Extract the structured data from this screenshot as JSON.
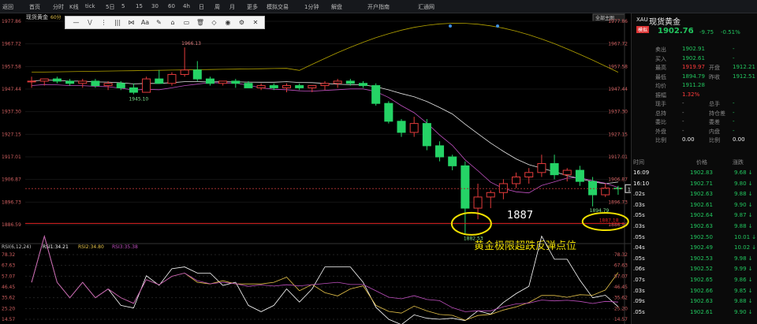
{
  "topbar": {
    "items": [
      "返回",
      "首页",
      "分时",
      "K线",
      "tick",
      "5日",
      "5",
      "15",
      "30",
      "60",
      "4h",
      "日",
      "周",
      "月",
      "更多",
      "模拟交易",
      "1分钟",
      "解盘",
      "开户指南",
      "汇通网"
    ]
  },
  "chart": {
    "title": "现货黄金",
    "period": "60分",
    "price_ticks": [
      "1977.86",
      "1967.72",
      "1957.58",
      "1947.44",
      "1937.30",
      "1927.15",
      "1917.01",
      "1906.87",
      "1896.73",
      "1886.59"
    ],
    "labels": {
      "high": "1966.13",
      "low_left": "1945.10",
      "low": "1882.53",
      "low_right": "1894.79",
      "last": "1902.76",
      "level": "1887.18",
      "level_note": "1887",
      "caption": "黄金极限超跌反弹点位",
      "main_indicator": "全部主图"
    },
    "rsi": {
      "header": "RSI(6,12,24)",
      "r1": "RSI1:34.21",
      "r2": "RSI2:34.80",
      "r3": "RSI3:35.38",
      "ticks": [
        "78.32",
        "67.63",
        "57.07",
        "46.45",
        "35.62",
        "25.20",
        "14.57"
      ]
    },
    "colors": {
      "up": "#e23b3b",
      "down": "#25d366",
      "ma1": "#e6e6e6",
      "ma2": "#b4a300",
      "ma3": "#c050c0"
    }
  },
  "chart_data": {
    "type": "candlestick",
    "x_count": 47,
    "candles": [
      {
        "o": 1951,
        "h": 1953,
        "l": 1948,
        "c": 1951
      },
      {
        "o": 1951,
        "h": 1952,
        "l": 1949,
        "c": 1952
      },
      {
        "o": 1952,
        "h": 1953,
        "l": 1950,
        "c": 1951
      },
      {
        "o": 1951,
        "h": 1952,
        "l": 1949,
        "c": 1950
      },
      {
        "o": 1950,
        "h": 1952,
        "l": 1948,
        "c": 1951
      },
      {
        "o": 1951,
        "h": 1952,
        "l": 1948,
        "c": 1949
      },
      {
        "o": 1949,
        "h": 1951,
        "l": 1947,
        "c": 1950
      },
      {
        "o": 1950,
        "h": 1951,
        "l": 1947,
        "c": 1948
      },
      {
        "o": 1948,
        "h": 1950,
        "l": 1945.1,
        "c": 1946
      },
      {
        "o": 1946,
        "h": 1953,
        "l": 1946,
        "c": 1952
      },
      {
        "o": 1952,
        "h": 1956,
        "l": 1950,
        "c": 1950
      },
      {
        "o": 1950,
        "h": 1955,
        "l": 1949,
        "c": 1954
      },
      {
        "o": 1954,
        "h": 1966.13,
        "l": 1953,
        "c": 1956
      },
      {
        "o": 1956,
        "h": 1960,
        "l": 1951,
        "c": 1952
      },
      {
        "o": 1952,
        "h": 1953,
        "l": 1949,
        "c": 1950
      },
      {
        "o": 1950,
        "h": 1951,
        "l": 1949,
        "c": 1951
      },
      {
        "o": 1951,
        "h": 1952,
        "l": 1948,
        "c": 1950
      },
      {
        "o": 1950,
        "h": 1951,
        "l": 1948,
        "c": 1948
      },
      {
        "o": 1948,
        "h": 1950,
        "l": 1947,
        "c": 1949
      },
      {
        "o": 1949,
        "h": 1950,
        "l": 1947,
        "c": 1948
      },
      {
        "o": 1948,
        "h": 1950,
        "l": 1946,
        "c": 1949
      },
      {
        "o": 1949,
        "h": 1950,
        "l": 1947,
        "c": 1948
      },
      {
        "o": 1948,
        "h": 1949,
        "l": 1946,
        "c": 1949
      },
      {
        "o": 1949,
        "h": 1951,
        "l": 1947,
        "c": 1950
      },
      {
        "o": 1950,
        "h": 1952,
        "l": 1948,
        "c": 1951
      },
      {
        "o": 1951,
        "h": 1952,
        "l": 1949,
        "c": 1950
      },
      {
        "o": 1950,
        "h": 1951,
        "l": 1948,
        "c": 1949
      },
      {
        "o": 1949,
        "h": 1950,
        "l": 1940,
        "c": 1941
      },
      {
        "o": 1941,
        "h": 1942,
        "l": 1932,
        "c": 1933
      },
      {
        "o": 1933,
        "h": 1934,
        "l": 1926,
        "c": 1928
      },
      {
        "o": 1928,
        "h": 1935,
        "l": 1926,
        "c": 1932
      },
      {
        "o": 1932,
        "h": 1934,
        "l": 1920,
        "c": 1922
      },
      {
        "o": 1922,
        "h": 1924,
        "l": 1915,
        "c": 1917
      },
      {
        "o": 1917,
        "h": 1918,
        "l": 1911,
        "c": 1913
      },
      {
        "o": 1913,
        "h": 1915,
        "l": 1882.53,
        "c": 1894
      },
      {
        "o": 1894,
        "h": 1905,
        "l": 1889,
        "c": 1899
      },
      {
        "o": 1899,
        "h": 1902,
        "l": 1894,
        "c": 1901
      },
      {
        "o": 1901,
        "h": 1907,
        "l": 1898,
        "c": 1905
      },
      {
        "o": 1905,
        "h": 1910,
        "l": 1903,
        "c": 1908
      },
      {
        "o": 1908,
        "h": 1912,
        "l": 1905,
        "c": 1910
      },
      {
        "o": 1910,
        "h": 1918,
        "l": 1908,
        "c": 1914
      },
      {
        "o": 1914,
        "h": 1918,
        "l": 1907,
        "c": 1909
      },
      {
        "o": 1909,
        "h": 1912,
        "l": 1906,
        "c": 1911
      },
      {
        "o": 1911,
        "h": 1913,
        "l": 1904,
        "c": 1906
      },
      {
        "o": 1906,
        "h": 1908,
        "l": 1894.79,
        "c": 1900
      },
      {
        "o": 1900,
        "h": 1905,
        "l": 1899,
        "c": 1903
      },
      {
        "o": 1903,
        "h": 1904,
        "l": 1900,
        "c": 1902.76
      }
    ],
    "ylim": [
      1886.59,
      1977.86
    ]
  },
  "side": {
    "code": "XAU",
    "name": "现货黄金",
    "tag": "模拟",
    "price": "1902.76",
    "arrow": "↓",
    "chg": "-9.75",
    "pct": "-0.51%",
    "rows": [
      {
        "k": "卖出",
        "v": "1902.91",
        "k2": "",
        "v2": "-",
        "c": "green"
      },
      {
        "k": "买入",
        "v": "1902.61",
        "k2": "",
        "v2": "-",
        "c": "green"
      },
      {
        "k": "最高",
        "v": "1919.97",
        "k2": "开盘",
        "v2": "1912.21",
        "c": "red"
      },
      {
        "k": "最低",
        "v": "1894.79",
        "k2": "昨收",
        "v2": "1912.51",
        "c": "green"
      },
      {
        "k": "均价",
        "v": "1911.28",
        "k2": "",
        "v2": "",
        "c": "green"
      },
      {
        "k": "振幅",
        "v": "1.32%",
        "k2": "",
        "v2": "",
        "c": "red"
      },
      {
        "k": "现手",
        "v": "-",
        "k2": "总手",
        "v2": "-",
        "c": "gray"
      },
      {
        "k": "总持",
        "v": "-",
        "k2": "持仓差",
        "v2": "-",
        "c": "gray"
      },
      {
        "k": "委比",
        "v": "-",
        "k2": "委差",
        "v2": "-",
        "c": "gray"
      },
      {
        "k": "外盘",
        "v": "-",
        "k2": "内盘",
        "v2": "-",
        "c": "gray"
      },
      {
        "k": "比例",
        "v": "0.00",
        "k2": "比例",
        "v2": "0.00",
        "c": "white"
      }
    ],
    "tick_header": [
      "时间",
      "价格",
      "涨跌"
    ],
    "ticks": [
      {
        "t": "16:09",
        "p": "1902.83",
        "d": "9.68",
        "c": "green"
      },
      {
        "t": "16:10",
        "p": "1902.71",
        "d": "9.80",
        "c": "green"
      },
      {
        "t": ".02s",
        "p": "1902.63",
        "d": "9.88",
        "c": "green"
      },
      {
        "t": ".03s",
        "p": "1902.61",
        "d": "9.90",
        "c": "green"
      },
      {
        "t": ".05s",
        "p": "1902.64",
        "d": "9.87",
        "c": "green"
      },
      {
        "t": ".03s",
        "p": "1902.63",
        "d": "9.88",
        "c": "green"
      },
      {
        "t": ".05s",
        "p": "1902.50",
        "d": "10.01",
        "c": "green"
      },
      {
        "t": ".04s",
        "p": "1902.49",
        "d": "10.02",
        "c": "green"
      },
      {
        "t": ".05s",
        "p": "1902.53",
        "d": "9.98",
        "c": "green"
      },
      {
        "t": ".06s",
        "p": "1902.52",
        "d": "9.99",
        "c": "green"
      },
      {
        "t": ".07s",
        "p": "1902.65",
        "d": "9.86",
        "c": "green"
      },
      {
        "t": ".03s",
        "p": "1902.66",
        "d": "9.85",
        "c": "green"
      },
      {
        "t": ".09s",
        "p": "1902.63",
        "d": "9.88",
        "c": "green"
      },
      {
        "t": ".05s",
        "p": "1902.61",
        "d": "9.90",
        "c": "green"
      }
    ]
  },
  "toolbar": {
    "items": [
      "—",
      "\\/",
      "⋮",
      "|||",
      "⋈",
      "Aa",
      "✎",
      "⌂",
      "▭",
      "🗑",
      "◇",
      "◉",
      "⚙",
      "✕"
    ]
  }
}
